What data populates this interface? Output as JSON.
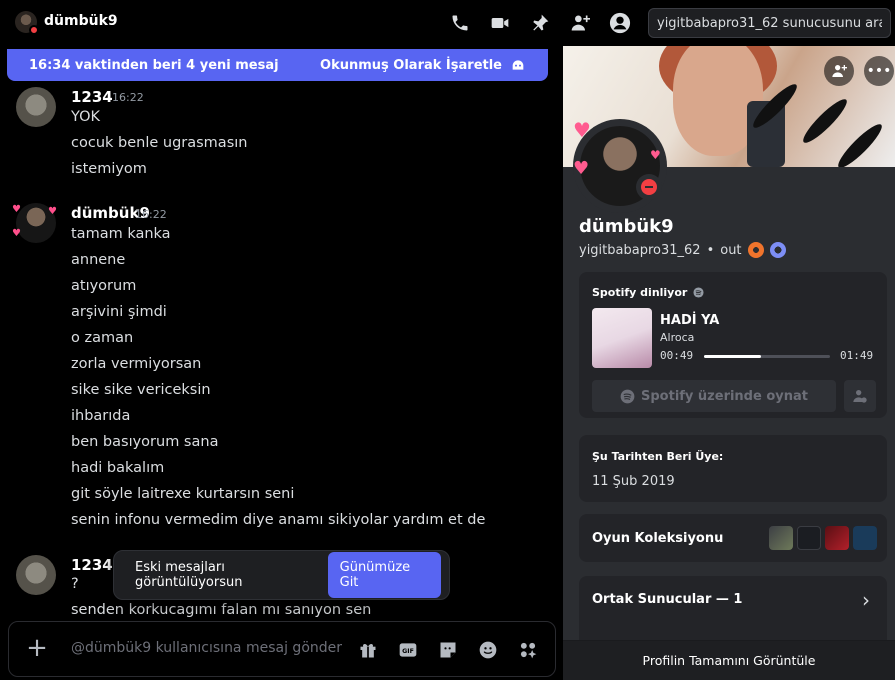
{
  "dm": {
    "title": "dümbük9"
  },
  "search": {
    "value": "yigitbabapro31_62 sunucusunu ara",
    "placeholder": "yigitbabapro31_62 sunucusunu ara"
  },
  "unread": {
    "text": "16:34 vaktinden beri 4 yeni mesaj",
    "mark_read": "Okunmuş Olarak İşaretle"
  },
  "messages": [
    {
      "author": "1234",
      "time": "16:22",
      "lines": [
        "YOK",
        "cocuk benle ugrasmasın",
        "istemiyom"
      ]
    },
    {
      "author": "dümbük9",
      "time": "16:22",
      "lines": [
        "tamam kanka",
        "annene",
        "atıyorum",
        "arşivini şimdi",
        "o zaman",
        "zorla vermiyorsan",
        "sike sike vericeksin",
        "ihbarıda",
        "ben basıyorum sana",
        "hadi bakalım",
        "git söyle laitrexe kurtarsın seni",
        "senin infonu vermedim diye anamı sikiyolar yardım et de"
      ]
    },
    {
      "author": "1234",
      "time": "",
      "lines": [
        "?",
        "senden korkucagımı falan mı sanıyon sen"
      ]
    }
  ],
  "jump": {
    "text": "Eski mesajları görüntülüyorsun",
    "button": "Günümüze Git"
  },
  "composer": {
    "placeholder": "@dümbük9 kullanıcısına mesaj gönder"
  },
  "profile": {
    "display_name": "dümbük9",
    "username": "yigitbabapro31_62",
    "pronouns": "out",
    "spotify": {
      "header": "Spotify dinliyor",
      "song": "HADİ YA",
      "artist": "Alroca",
      "elapsed": "00:49",
      "duration": "01:49",
      "progress": 0.45,
      "play_button": "Spotify üzerinde oynat"
    },
    "member_since_label": "Şu Tarihten Beri Üye:",
    "member_since": "11 Şub 2019",
    "games_label": "Oyun Koleksiyonu",
    "mutual_servers": "Ortak Sunucular — 1",
    "view_full": "Profilin Tamamını Görüntüle"
  },
  "colors": {
    "accent": "#5865f2",
    "dnd": "#f23f43",
    "panel": "#2b2d31",
    "card": "#232428"
  },
  "icons": [
    "phone-icon",
    "video-icon",
    "pin-icon",
    "add-friend-icon",
    "profile-icon",
    "plus-icon",
    "gift-icon",
    "gif-icon",
    "sticker-icon",
    "emoji-icon",
    "apps-icon",
    "chevron-right-icon",
    "more-icon",
    "spotify-icon"
  ]
}
